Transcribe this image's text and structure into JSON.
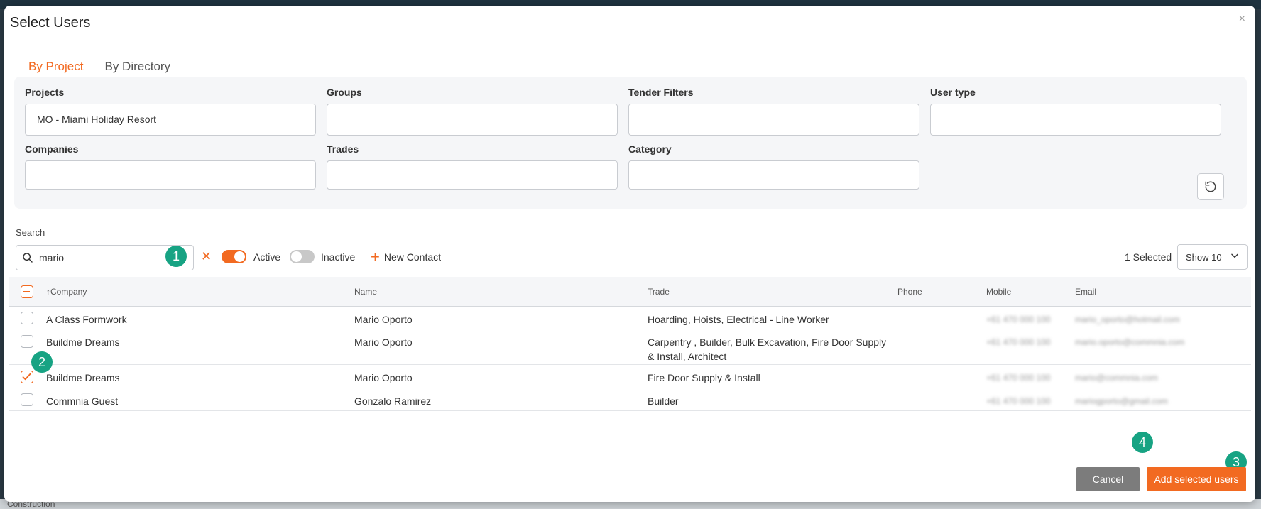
{
  "background_footer_text": "Construction",
  "dialog": {
    "title": "Select Users",
    "close_glyph": "×"
  },
  "tabs": [
    {
      "label": "By Project",
      "active": true
    },
    {
      "label": "By Directory",
      "active": false
    }
  ],
  "filters": {
    "projects": {
      "label": "Projects",
      "value": "MO - Miami Holiday Resort"
    },
    "groups": {
      "label": "Groups",
      "value": ""
    },
    "tender_filters": {
      "label": "Tender Filters",
      "value": ""
    },
    "user_type": {
      "label": "User type",
      "value": ""
    },
    "companies": {
      "label": "Companies",
      "value": ""
    },
    "trades": {
      "label": "Trades",
      "value": ""
    },
    "category": {
      "label": "Category",
      "value": ""
    },
    "refresh_icon": "refresh-icon"
  },
  "search": {
    "label": "Search",
    "value": "mario",
    "clear_glyph": "✕"
  },
  "toggles": {
    "active": {
      "label": "Active",
      "on": true
    },
    "inactive": {
      "label": "Inactive",
      "on": false
    }
  },
  "new_contact_label": "New Contact",
  "selected_count": "1 Selected",
  "page_size": "Show 10",
  "table": {
    "columns": {
      "company": "↑Company",
      "name": "Name",
      "trade": "Trade",
      "phone": "Phone",
      "mobile": "Mobile",
      "email": "Email"
    },
    "rows": [
      {
        "company": "A Class Formwork",
        "name": "Mario Oporto",
        "trade": "Hoarding, Hoists, Electrical - Line Worker",
        "phone": "",
        "mobile": "+61 470 000 100",
        "email": "mario_oporto@hotmail.com",
        "checked": false
      },
      {
        "company": "Buildme Dreams",
        "name": "Mario Oporto",
        "trade_line1": "Carpentry , Builder, Bulk Excavation, Fire Door Supply",
        "trade_line2": "& Install, Architect",
        "phone": "",
        "mobile": "+61 470 000 100",
        "email": "mario.oporto@commnia.com",
        "checked": false
      },
      {
        "company": "Buildme Dreams",
        "name": "Mario Oporto",
        "trade": "Fire Door Supply & Install",
        "phone": "",
        "mobile": "+61 470 000 100",
        "email": "mario@commnia.com",
        "checked": true
      },
      {
        "company": "Commnia Guest",
        "name": "Gonzalo Ramirez",
        "trade": "Builder",
        "phone": "",
        "mobile": "+61 470 000 100",
        "email": "mariogporto@gmail.com",
        "checked": false
      }
    ]
  },
  "annotations": [
    "1",
    "2",
    "3",
    "4"
  ],
  "buttons": {
    "cancel": "Cancel",
    "add": "Add selected users"
  },
  "colors": {
    "accent": "#f26a21",
    "badge": "#17a383",
    "cancel_bg": "#7c7c7c"
  }
}
